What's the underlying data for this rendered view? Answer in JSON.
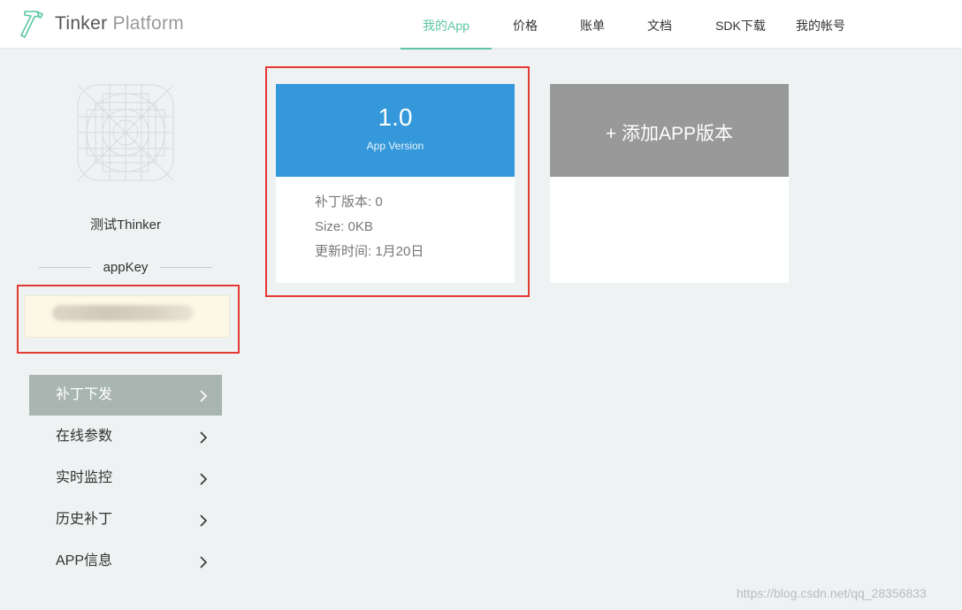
{
  "header": {
    "brand_bold": "Tinker",
    "brand_light": "Platform",
    "nav": [
      {
        "label": "我的App",
        "active": true
      },
      {
        "label": "价格",
        "active": false
      },
      {
        "label": "账单",
        "active": false
      },
      {
        "label": "文档",
        "active": false
      },
      {
        "label": "SDK下载",
        "active": false
      },
      {
        "label": "我的帐号",
        "active": false
      }
    ]
  },
  "sidebar": {
    "app_name": "测试Thinker",
    "appkey_label": "appKey",
    "menu": [
      {
        "label": "补丁下发",
        "active": true
      },
      {
        "label": "在线参数",
        "active": false
      },
      {
        "label": "实时监控",
        "active": false
      },
      {
        "label": "历史补丁",
        "active": false
      },
      {
        "label": "APP信息",
        "active": false
      }
    ]
  },
  "version_card": {
    "version": "1.0",
    "subtitle": "App Version",
    "patch_version": "补丁版本: 0",
    "size": "Size: 0KB",
    "updated": "更新时间: 1月20日"
  },
  "add_card": {
    "label": "+ 添加APP版本"
  },
  "watermark": "https://blog.csdn.net/qq_28356833",
  "colors": {
    "accent": "#5cc5a5",
    "version_blue": "#3498db",
    "add_gray": "#999999",
    "menu_active": "#a9b5b1",
    "highlight_red": "#e53935"
  }
}
